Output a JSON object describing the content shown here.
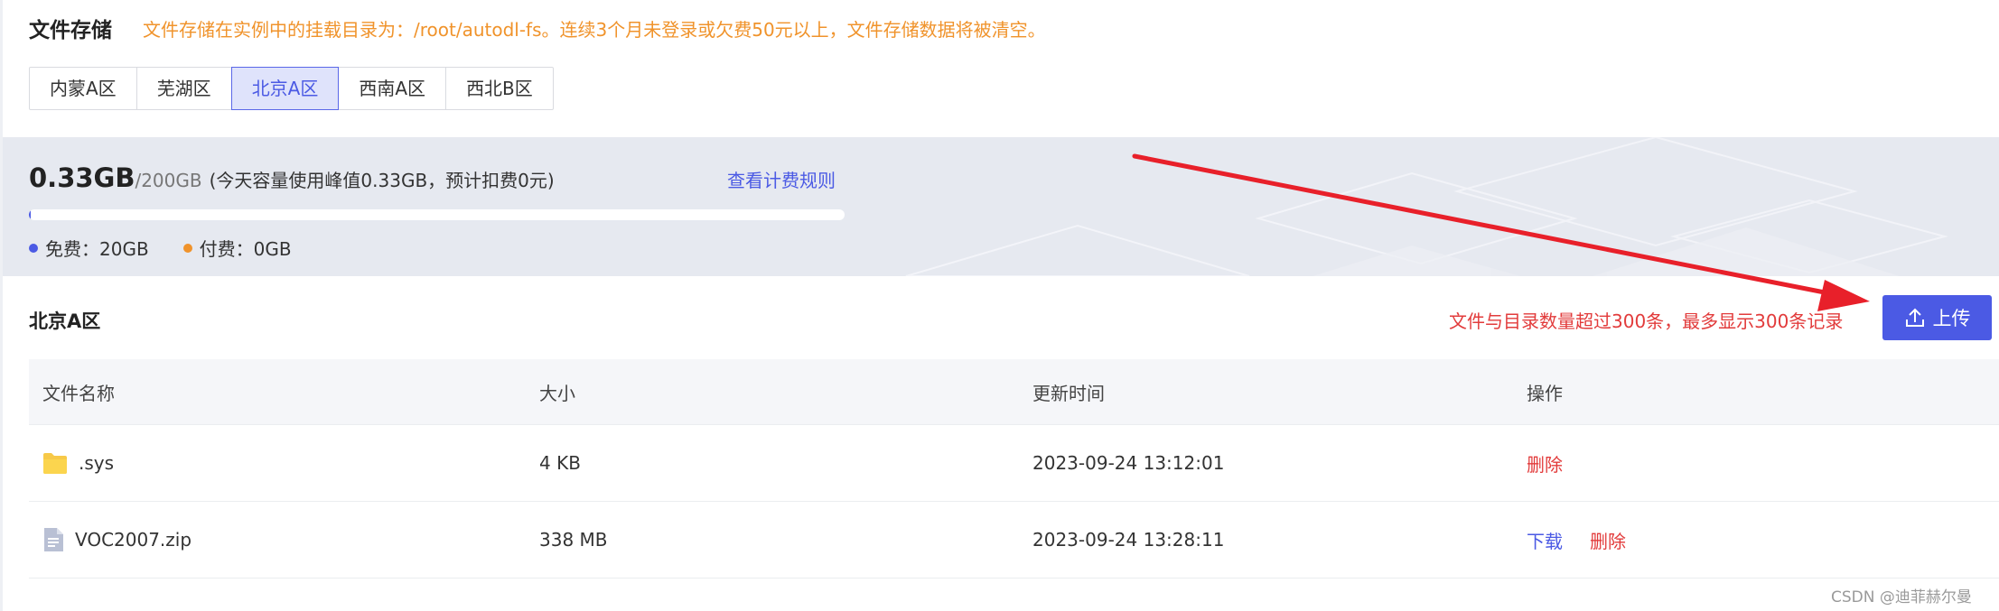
{
  "header": {
    "title": "文件存储",
    "notice": "文件存储在实例中的挂载目录为：/root/autodl-fs。连续3个月未登录或欠费50元以上，文件存储数据将被清空。"
  },
  "regions": [
    {
      "label": "内蒙A区",
      "active": false
    },
    {
      "label": "芜湖区",
      "active": false
    },
    {
      "label": "北京A区",
      "active": true
    },
    {
      "label": "西南A区",
      "active": false
    },
    {
      "label": "西北B区",
      "active": false
    }
  ],
  "storage": {
    "used": "0.33GB",
    "total": "/200GB",
    "note": "(今天容量使用峰值0.33GB，预计扣费0元)",
    "rules_link": "查看计费规则",
    "usage_fraction": 0.00165,
    "free_label": "免费：20GB",
    "paid_label": "付费：0GB",
    "free_color": "#4b5ae4",
    "paid_color": "#f0932b"
  },
  "section": {
    "title": "北京A区",
    "limit_note": "文件与目录数量超过300条，最多显示300条记录",
    "upload_label": "上传"
  },
  "table": {
    "columns": [
      "文件名称",
      "大小",
      "更新时间",
      "操作"
    ],
    "rows": [
      {
        "name": ".sys",
        "icon": "folder-icon",
        "size": "4 KB",
        "updated": "2023-09-24 13:12:01",
        "actions": [
          "删除"
        ]
      },
      {
        "name": "VOC2007.zip",
        "icon": "file-icon",
        "size": "338 MB",
        "updated": "2023-09-24 13:28:11",
        "actions": [
          "下载",
          "删除"
        ]
      }
    ]
  },
  "watermark": "CSDN @迪菲赫尔曼",
  "colors": {
    "accent": "#4b5ae4",
    "warning": "#f0932b",
    "danger": "#e23b3b",
    "annotation_arrow": "#e8202a"
  }
}
